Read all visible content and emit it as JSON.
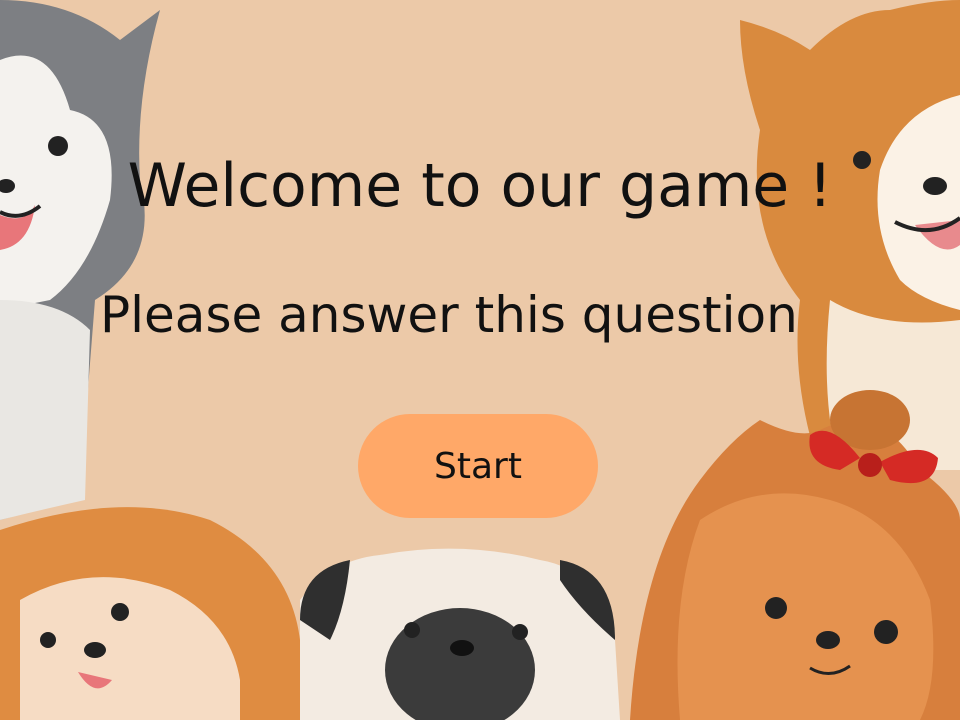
{
  "screen": {
    "title": "Welcome to our game !",
    "subtitle": "Please answer this question",
    "start_label": "Start"
  },
  "colors": {
    "background": "#ecc9a8",
    "start_button": "#ffa868",
    "text": "#111111"
  },
  "decorations": [
    "husky-dog",
    "shiba-dog",
    "pomeranian-dog",
    "pug-dog",
    "yorkshire-terrier-dog",
    "red-bow"
  ]
}
